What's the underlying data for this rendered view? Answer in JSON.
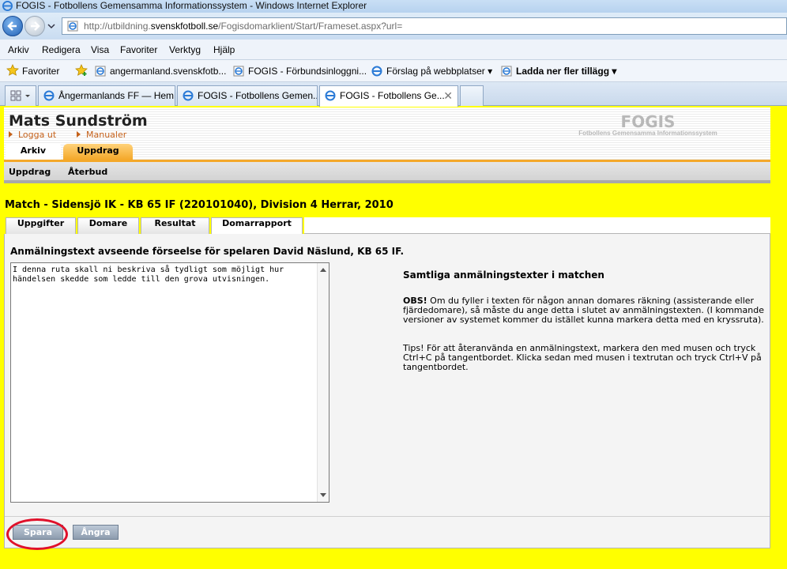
{
  "browser": {
    "title": "FOGIS - Fotbollens Gemensamma Informationssystem - Windows Internet Explorer",
    "url_prefix": "http://utbildning.",
    "url_domain": "svenskfotboll.se",
    "url_suffix": "/Fogisdomarklient/Start/Frameset.aspx?url=",
    "menu": [
      "Arkiv",
      "Redigera",
      "Visa",
      "Favoriter",
      "Verktyg",
      "Hjälp"
    ],
    "favorites_label": "Favoriter",
    "favorites": [
      "angermanland.svenskfotb...",
      "FOGIS - Förbundsinloggni...",
      "Förslag på webbplatser",
      "Ladda ner fler tillägg"
    ],
    "tabs": [
      "Ångermanlands FF — Hem",
      "FOGIS - Fotbollens Gemen...",
      "FOGIS - Fotbollens Ge..."
    ]
  },
  "header": {
    "user_name": "Mats Sundström",
    "logout_label": "Logga ut",
    "manuals_label": "Manualer",
    "logo_title": "FOGIS",
    "logo_subtitle": "Fotbollens Gemensamma Informationssystem",
    "tabs": [
      "Arkiv",
      "Uppdrag"
    ]
  },
  "subnav": [
    "Uppdrag",
    "Återbud"
  ],
  "match_title": "Match - Sidensjö IK - KB 65 IF (220101040), Division 4 Herrar, 2010",
  "content_tabs": [
    "Uppgifter",
    "Domare",
    "Resultat",
    "Domarrapport"
  ],
  "report": {
    "heading": "Anmälningstext avseende förseelse för spelaren David Näslund, KB 65 IF.",
    "text": "I denna ruta skall ni beskriva så tydligt som möjligt hur händelsen skedde som ledde till den grova utvisningen.",
    "all_texts_title": "Samtliga anmälningstexter i matchen",
    "obs_label": "OBS!",
    "obs_text": " Om du fyller i texten för någon annan domares räkning (assisterande eller fjärdedomare), så måste du ange detta i slutet av anmälningstexten. (I kommande versioner av systemet kommer du istället kunna markera detta med en kryssruta).",
    "tips_text": "Tips! För att återanvända en anmälningstext, markera den med musen och tryck Ctrl+C på tangentbordet. Klicka sedan med musen i textrutan och tryck Ctrl+V på tangentbordet."
  },
  "actions": {
    "save_label": "Spara",
    "undo_label": "Ångra"
  },
  "colors": {
    "page_background": "#ffff00",
    "accent": "#f4a82a",
    "highlight": "#e0112b"
  }
}
